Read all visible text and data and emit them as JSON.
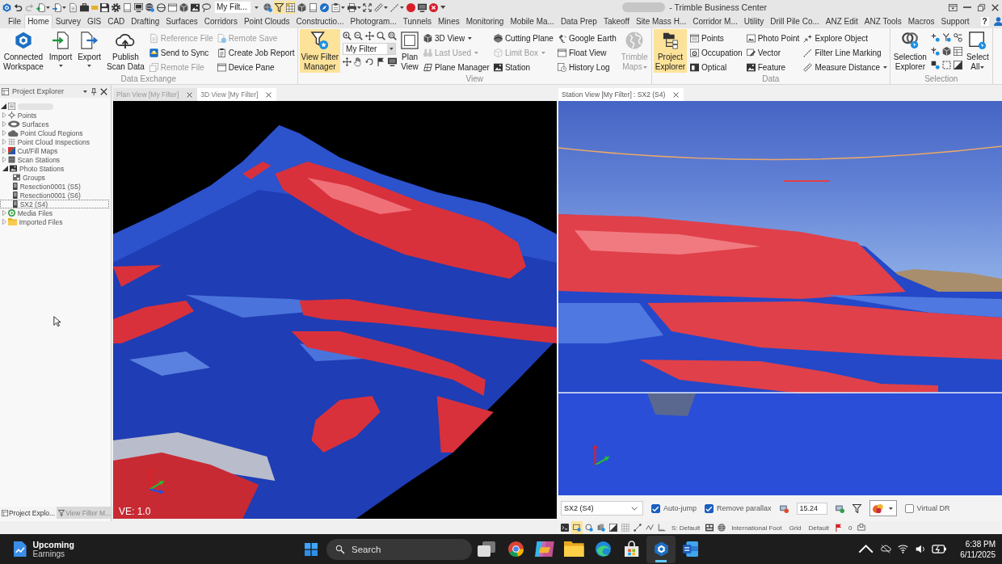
{
  "title_bar": {
    "tools": [
      {
        "kind": "tool",
        "on": false
      },
      {
        "kind": "tool",
        "on": false
      },
      {
        "kind": "tool",
        "on": false
      },
      {
        "kind": "tool",
        "on": false
      },
      {
        "kind": "tool",
        "on": false
      },
      {
        "kind": "tool",
        "on": false
      },
      {
        "kind": "tool",
        "on": false
      },
      {
        "kind": "tool",
        "on": false
      },
      {
        "kind": "tool",
        "on": false
      },
      {
        "kind": "tool",
        "on": false
      },
      {
        "kind": "tool",
        "on": false
      },
      {
        "kind": "tool",
        "on": false
      },
      {
        "kind": "tool",
        "on": false
      },
      {
        "kind": "tool",
        "on": false
      },
      {
        "kind": "tool",
        "on": false
      },
      {
        "kind": "tool",
        "on": false
      },
      {
        "kind": "tool",
        "on": false
      },
      {
        "kind": "tool",
        "on": false
      },
      {
        "kind": "combo",
        "value": "My Filt..."
      },
      {
        "kind": "tool",
        "on": false
      },
      {
        "kind": "tool",
        "on": true
      },
      {
        "kind": "tool",
        "on": true
      },
      {
        "kind": "tool",
        "on": false
      },
      {
        "kind": "tool",
        "on": false
      },
      {
        "kind": "tool",
        "on": false
      },
      {
        "kind": "tool",
        "on": false
      },
      {
        "kind": "tool",
        "on": false
      },
      {
        "kind": "tool",
        "on": false
      },
      {
        "kind": "tool",
        "on": false
      },
      {
        "kind": "tool",
        "on": false
      },
      {
        "kind": "tool",
        "on": false
      },
      {
        "kind": "tool",
        "on": false
      },
      {
        "kind": "tool",
        "on": false
      },
      {
        "kind": "tool",
        "on": false
      }
    ],
    "title": "- Trimble Business Center"
  },
  "menu_tabs": [
    {
      "label": "File",
      "selected": false
    },
    {
      "label": "Home",
      "selected": true
    },
    {
      "label": "Survey",
      "selected": false
    },
    {
      "label": "GIS",
      "selected": false
    },
    {
      "label": "CAD",
      "selected": false
    },
    {
      "label": "Drafting",
      "selected": false
    },
    {
      "label": "Surfaces",
      "selected": false
    },
    {
      "label": "Corridors",
      "selected": false
    },
    {
      "label": "Point Clouds",
      "selected": false
    },
    {
      "label": "Constructio...",
      "selected": false
    },
    {
      "label": "Photogram...",
      "selected": false
    },
    {
      "label": "Tunnels",
      "selected": false
    },
    {
      "label": "Mines",
      "selected": false
    },
    {
      "label": "Monitoring",
      "selected": false
    },
    {
      "label": "Mobile Ma...",
      "selected": false
    },
    {
      "label": "Data Prep",
      "selected": false
    },
    {
      "label": "Takeoff",
      "selected": false
    },
    {
      "label": "Site Mass H...",
      "selected": false
    },
    {
      "label": "Corridor M...",
      "selected": false
    },
    {
      "label": "Utility",
      "selected": false
    },
    {
      "label": "Drill Pile Co...",
      "selected": false
    },
    {
      "label": "ANZ Edit",
      "selected": false
    },
    {
      "label": "ANZ Tools",
      "selected": false
    },
    {
      "label": "Macros",
      "selected": false
    },
    {
      "label": "Support",
      "selected": false
    }
  ],
  "help_button": "?",
  "ribbon": [
    {
      "caption": "Data Exchange",
      "items": [
        {
          "kind": "large",
          "label": "Connected\nWorkspace",
          "on": false,
          "disabled": false,
          "dropdown": false
        },
        {
          "kind": "large",
          "label": "Import",
          "on": false,
          "disabled": false,
          "dropdown": true
        },
        {
          "kind": "large",
          "label": "Export",
          "on": false,
          "disabled": false,
          "dropdown": true
        },
        {
          "kind": "large",
          "label": "Publish\nScan Data",
          "on": false,
          "disabled": false,
          "dropdown": false
        },
        {
          "kind": "column",
          "buttons": [
            {
              "label": "Reference File",
              "disabled": true,
              "dropdown": false
            },
            {
              "label": "Send to Sync",
              "disabled": false,
              "dropdown": false
            },
            {
              "label": "Remote File",
              "disabled": true,
              "dropdown": false
            }
          ]
        },
        {
          "kind": "column",
          "buttons": [
            {
              "label": "Remote Save",
              "disabled": true,
              "dropdown": false
            },
            {
              "label": "Create Job Report",
              "disabled": false,
              "dropdown": false
            },
            {
              "label": "Device Pane",
              "disabled": false,
              "dropdown": false
            }
          ]
        }
      ]
    },
    {
      "caption": "View",
      "items": [
        {
          "kind": "large",
          "label": "View Filter\nManager",
          "on": true,
          "disabled": false,
          "dropdown": false
        },
        {
          "kind": "view_tools",
          "filter": "My Filter"
        },
        {
          "kind": "large",
          "label": "Plan\nView",
          "on": false,
          "disabled": false,
          "dropdown": false
        },
        {
          "kind": "column",
          "buttons": [
            {
              "label": "3D View",
              "disabled": false,
              "dropdown": true
            },
            {
              "label": "Last Used",
              "disabled": true,
              "dropdown": true
            },
            {
              "label": "Plane Manager",
              "disabled": false,
              "dropdown": false
            }
          ]
        },
        {
          "kind": "column",
          "buttons": [
            {
              "label": "Cutting Plane",
              "disabled": false,
              "dropdown": false
            },
            {
              "label": "Limit Box",
              "disabled": true,
              "dropdown": true
            },
            {
              "label": "Station",
              "disabled": false,
              "dropdown": false
            }
          ]
        },
        {
          "kind": "column",
          "buttons": [
            {
              "label": "Google Earth",
              "disabled": false,
              "dropdown": false
            },
            {
              "label": "Float View",
              "disabled": false,
              "dropdown": false
            },
            {
              "label": "History Log",
              "disabled": false,
              "dropdown": false
            }
          ]
        },
        {
          "kind": "large",
          "label": "Trimble\nMaps",
          "on": false,
          "disabled": true,
          "dropdown": true
        }
      ]
    },
    {
      "caption": "Data",
      "items": [
        {
          "kind": "large",
          "label": "Project\nExplorer",
          "on": true,
          "disabled": false,
          "dropdown": false
        },
        {
          "kind": "column",
          "buttons": [
            {
              "label": "Points",
              "disabled": false,
              "dropdown": false
            },
            {
              "label": "Occupation",
              "disabled": false,
              "dropdown": false
            },
            {
              "label": "Optical",
              "disabled": false,
              "dropdown": false
            }
          ]
        },
        {
          "kind": "column",
          "buttons": [
            {
              "label": "Photo Point",
              "disabled": false,
              "dropdown": false
            },
            {
              "label": "Vector",
              "disabled": false,
              "dropdown": false
            },
            {
              "label": "Feature",
              "disabled": false,
              "dropdown": false
            }
          ]
        },
        {
          "kind": "column",
          "buttons": [
            {
              "label": "Explore Object",
              "disabled": false,
              "dropdown": false
            },
            {
              "label": "Filter Line Marking",
              "disabled": false,
              "dropdown": false
            },
            {
              "label": "Measure Distance",
              "disabled": false,
              "dropdown": true
            }
          ]
        }
      ]
    },
    {
      "caption": "Selection",
      "items": [
        {
          "kind": "large",
          "label": "Selection\nExplorer",
          "on": false,
          "disabled": false,
          "dropdown": false
        },
        {
          "kind": "icon_grid"
        },
        {
          "kind": "large",
          "label": "Select\nAll",
          "on": false,
          "disabled": false,
          "dropdown": true
        }
      ]
    }
  ],
  "project_explorer": {
    "title": "Project Explorer",
    "tree": {
      "expanded": true,
      "selected": false,
      "children": [
        {
          "label": "Points",
          "expanded": false,
          "selected": false
        },
        {
          "label": "Surfaces",
          "expanded": false,
          "selected": false
        },
        {
          "label": "Point Cloud Regions",
          "expanded": false,
          "selected": false
        },
        {
          "label": "Point Cloud Inspections",
          "expanded": false,
          "selected": false
        },
        {
          "label": "Cut/Fill Maps",
          "expanded": false,
          "selected": false
        },
        {
          "label": "Scan Stations",
          "expanded": false,
          "selected": false
        },
        {
          "label": "Photo Stations",
          "expanded": true,
          "selected": false,
          "children": [
            {
              "label": "Groups",
              "selected": false
            },
            {
              "label": "Resection0001 (S5)",
              "selected": false
            },
            {
              "label": "Resection0001 (S6)",
              "selected": false
            },
            {
              "label": "SX2 (S4)",
              "selected": true
            }
          ]
        },
        {
          "label": "Media Files",
          "expanded": false,
          "selected": false
        },
        {
          "label": "Imported Files",
          "expanded": false,
          "selected": false
        }
      ]
    },
    "bottom_tabs": [
      {
        "label": "Project Explo...",
        "selected": true
      },
      {
        "label": "View Filter M...",
        "selected": false
      }
    ]
  },
  "view_tabs": [
    {
      "label": "Plan View [My Filter]",
      "selected": false
    },
    {
      "label": "3D View [My Filter]",
      "selected": true
    }
  ],
  "view_3d": {
    "ve_label": "VE: 1.0"
  },
  "station_view": {
    "tab": {
      "label": "Station View [My Filter] : SX2 (S4)",
      "selected": true
    },
    "controls": [
      {
        "kind": "dropdown",
        "value": "SX2 (S4)"
      },
      {
        "kind": "checkbox",
        "label": "Auto-jump",
        "checked": true
      },
      {
        "kind": "checkbox",
        "label": "Remove parallax",
        "checked": true
      },
      {
        "kind": "tool"
      },
      {
        "kind": "field",
        "value": "15.24"
      },
      {
        "kind": "tool"
      },
      {
        "kind": "tool"
      },
      {
        "kind": "swatch_dropdown"
      },
      {
        "kind": "checkbox",
        "label": "Virtual DR",
        "checked": false
      }
    ]
  },
  "status_bar": {
    "items": [
      {
        "kind": "tool",
        "on": false
      },
      {
        "kind": "tool",
        "on": true
      },
      {
        "kind": "tool",
        "on": false
      },
      {
        "kind": "tool",
        "on": false
      },
      {
        "kind": "tool",
        "on": false
      },
      {
        "kind": "tool",
        "on": false
      },
      {
        "kind": "tool",
        "on": false
      },
      {
        "kind": "tool",
        "on": false
      },
      {
        "kind": "tool",
        "on": false
      },
      {
        "kind": "text",
        "label": "S: Default"
      },
      {
        "kind": "tool",
        "on": false
      },
      {
        "kind": "tool",
        "on": false
      },
      {
        "kind": "text",
        "label": "International Foot"
      },
      {
        "kind": "text",
        "label": "Grid"
      },
      {
        "kind": "text",
        "label": "Default"
      },
      {
        "kind": "tool",
        "on": false
      },
      {
        "kind": "text",
        "label": "0"
      },
      {
        "kind": "tool",
        "on": false
      }
    ]
  },
  "taskbar": {
    "widget": {
      "title": "Upcoming",
      "subtitle": "Earnings"
    },
    "search": {
      "placeholder": "Search"
    },
    "apps": [
      {
        "active": false
      },
      {
        "active": false
      },
      {
        "active": false
      },
      {
        "active": false
      },
      {
        "active": false
      },
      {
        "active": false
      },
      {
        "active": true
      },
      {
        "active": false
      }
    ],
    "time": "6:38 PM",
    "date": "6/11/2025"
  }
}
